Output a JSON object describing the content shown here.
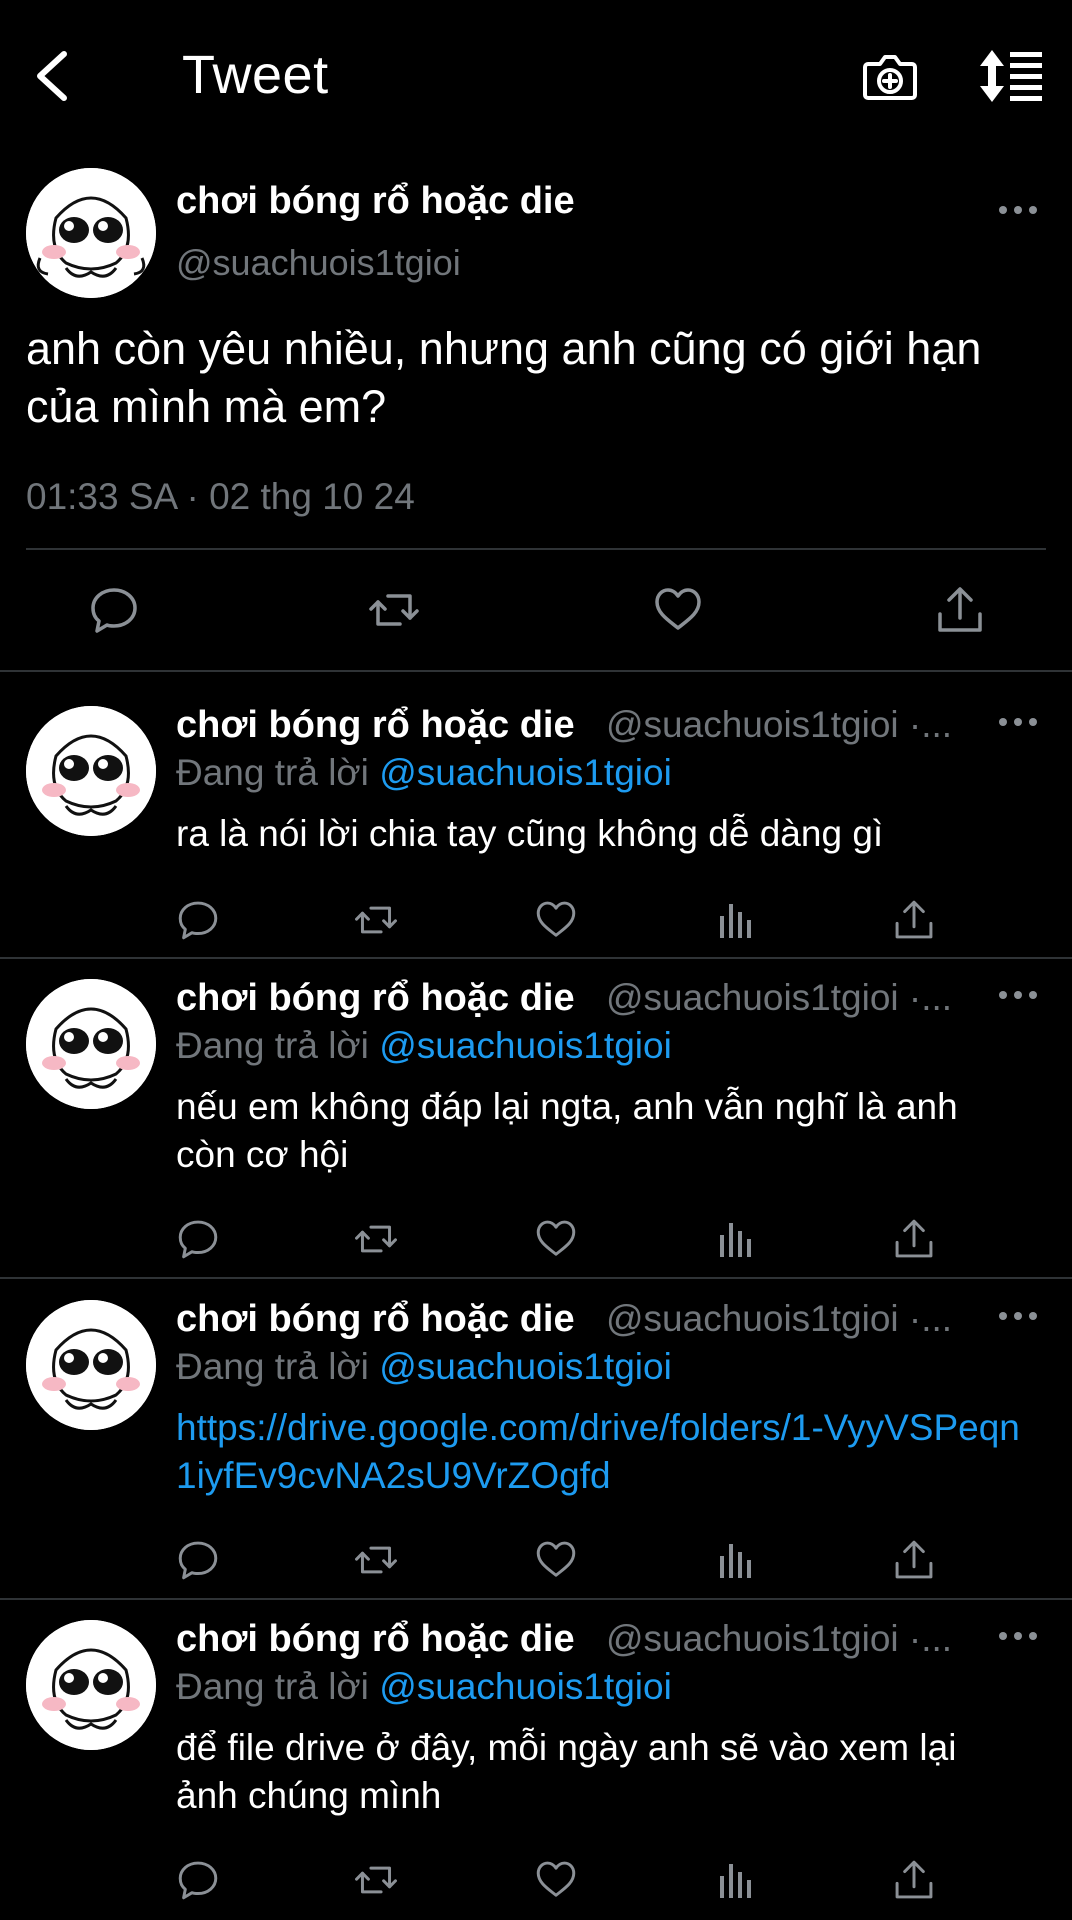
{
  "header": {
    "title": "Tweet",
    "back_icon": "chevron-left-icon",
    "camera_icon": "camera-plus-icon",
    "sort_icon": "sort-list-icon"
  },
  "main_tweet": {
    "author_name": "chơi bóng rổ hoặc die",
    "author_handle": "@suachuois1tgioi",
    "text": "anh còn yêu nhiều, nhưng anh cũng có giới hạn của mình mà em?",
    "timestamp": "01:33 SA · 02 thg 10 24"
  },
  "replies": [
    {
      "author_name": "chơi bóng rổ hoặc die",
      "author_handle": "@suachuois1tgioi ·...",
      "reply_prefix": "Đang trả lời",
      "reply_mention": "@suachuois1tgioi",
      "text": "ra là nói lời chia tay cũng không dễ dàng gì"
    },
    {
      "author_name": "chơi bóng rổ hoặc die",
      "author_handle": "@suachuois1tgioi ·...",
      "reply_prefix": "Đang trả lời",
      "reply_mention": "@suachuois1tgioi",
      "text": "nếu em không đáp lại ngta, anh vẫn nghĩ là anh còn cơ hội"
    },
    {
      "author_name": "chơi bóng rổ hoặc die",
      "author_handle": "@suachuois1tgioi ·...",
      "reply_prefix": "Đang trả lời",
      "reply_mention": "@suachuois1tgioi",
      "text": "https://drive.google.com/drive/folders/1-VyyVSPeqn1iyfEv9cvNA2sU9VrZOgfd"
    },
    {
      "author_name": "chơi bóng rổ hoặc die",
      "author_handle": "@suachuois1tgioi ·...",
      "reply_prefix": "Đang trả lời",
      "reply_mention": "@suachuois1tgioi",
      "text": "để file drive ở đây, mỗi ngày anh sẽ vào xem lại ảnh chúng mình"
    }
  ],
  "colors": {
    "background": "#000000",
    "text_primary": "#ffffff",
    "text_secondary": "#71767b",
    "link": "#1d9bf0",
    "divider": "#2f3336"
  }
}
